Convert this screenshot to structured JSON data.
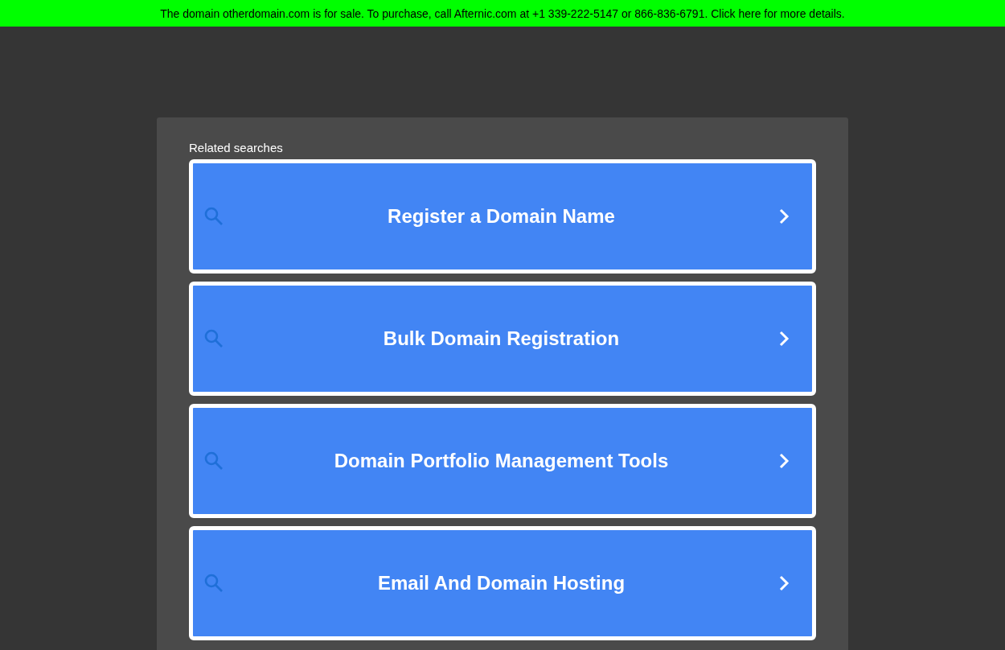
{
  "sale_banner": {
    "text": "The domain otherdomain.com is for sale. To purchase, call Afternic.com at +1 339-222-5147 or 866-836-6791. Click here for more details."
  },
  "related_searches": {
    "heading": "Related searches",
    "items": [
      {
        "label": "Register a Domain Name"
      },
      {
        "label": "Bulk Domain Registration"
      },
      {
        "label": "Domain Portfolio Management Tools"
      },
      {
        "label": "Email And Domain Hosting"
      }
    ]
  }
}
